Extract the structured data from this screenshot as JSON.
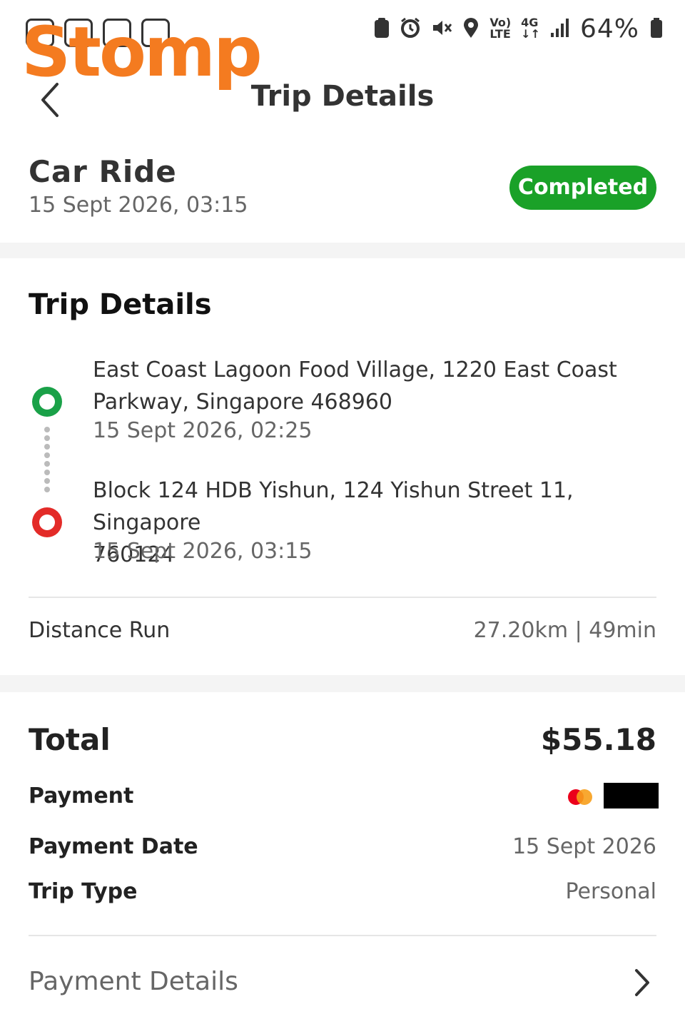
{
  "status_bar": {
    "battery": "64%",
    "icons": [
      "clipboard-icon",
      "alarm-icon",
      "mute-icon",
      "location-icon",
      "volte-icon",
      "4g-icon",
      "signal-icon",
      "battery-icon"
    ]
  },
  "logo": {
    "text": "Stomp",
    "color": "#f47b20"
  },
  "header": {
    "title": "Trip Details"
  },
  "ride": {
    "type": "Car Ride",
    "datetime": "15 Sept 2026, 03:15",
    "status": "Completed",
    "status_color": "#1aa128"
  },
  "trip": {
    "section_title": "Trip Details",
    "pickup": {
      "address_line1": "East Coast Lagoon Food Village, 1220 East Coast",
      "address_line2": "Parkway, Singapore 468960",
      "time": "15 Sept 2026, 02:25"
    },
    "dropoff": {
      "address_line1": "Block 124 HDB Yishun, 124 Yishun Street 11, Singapore",
      "address_line2": "760124",
      "time": "15 Sept 2026, 03:15"
    },
    "distance_label": "Distance Run",
    "distance_value": "27.20km | 49min"
  },
  "summary": {
    "total_label": "Total",
    "total_value": "$55.18",
    "payment_label": "Payment",
    "payment_date_label": "Payment Date",
    "payment_date_value": "15 Sept 2026",
    "trip_type_label": "Trip Type",
    "trip_type_value": "Personal"
  },
  "payment_details": {
    "label": "Payment Details"
  }
}
